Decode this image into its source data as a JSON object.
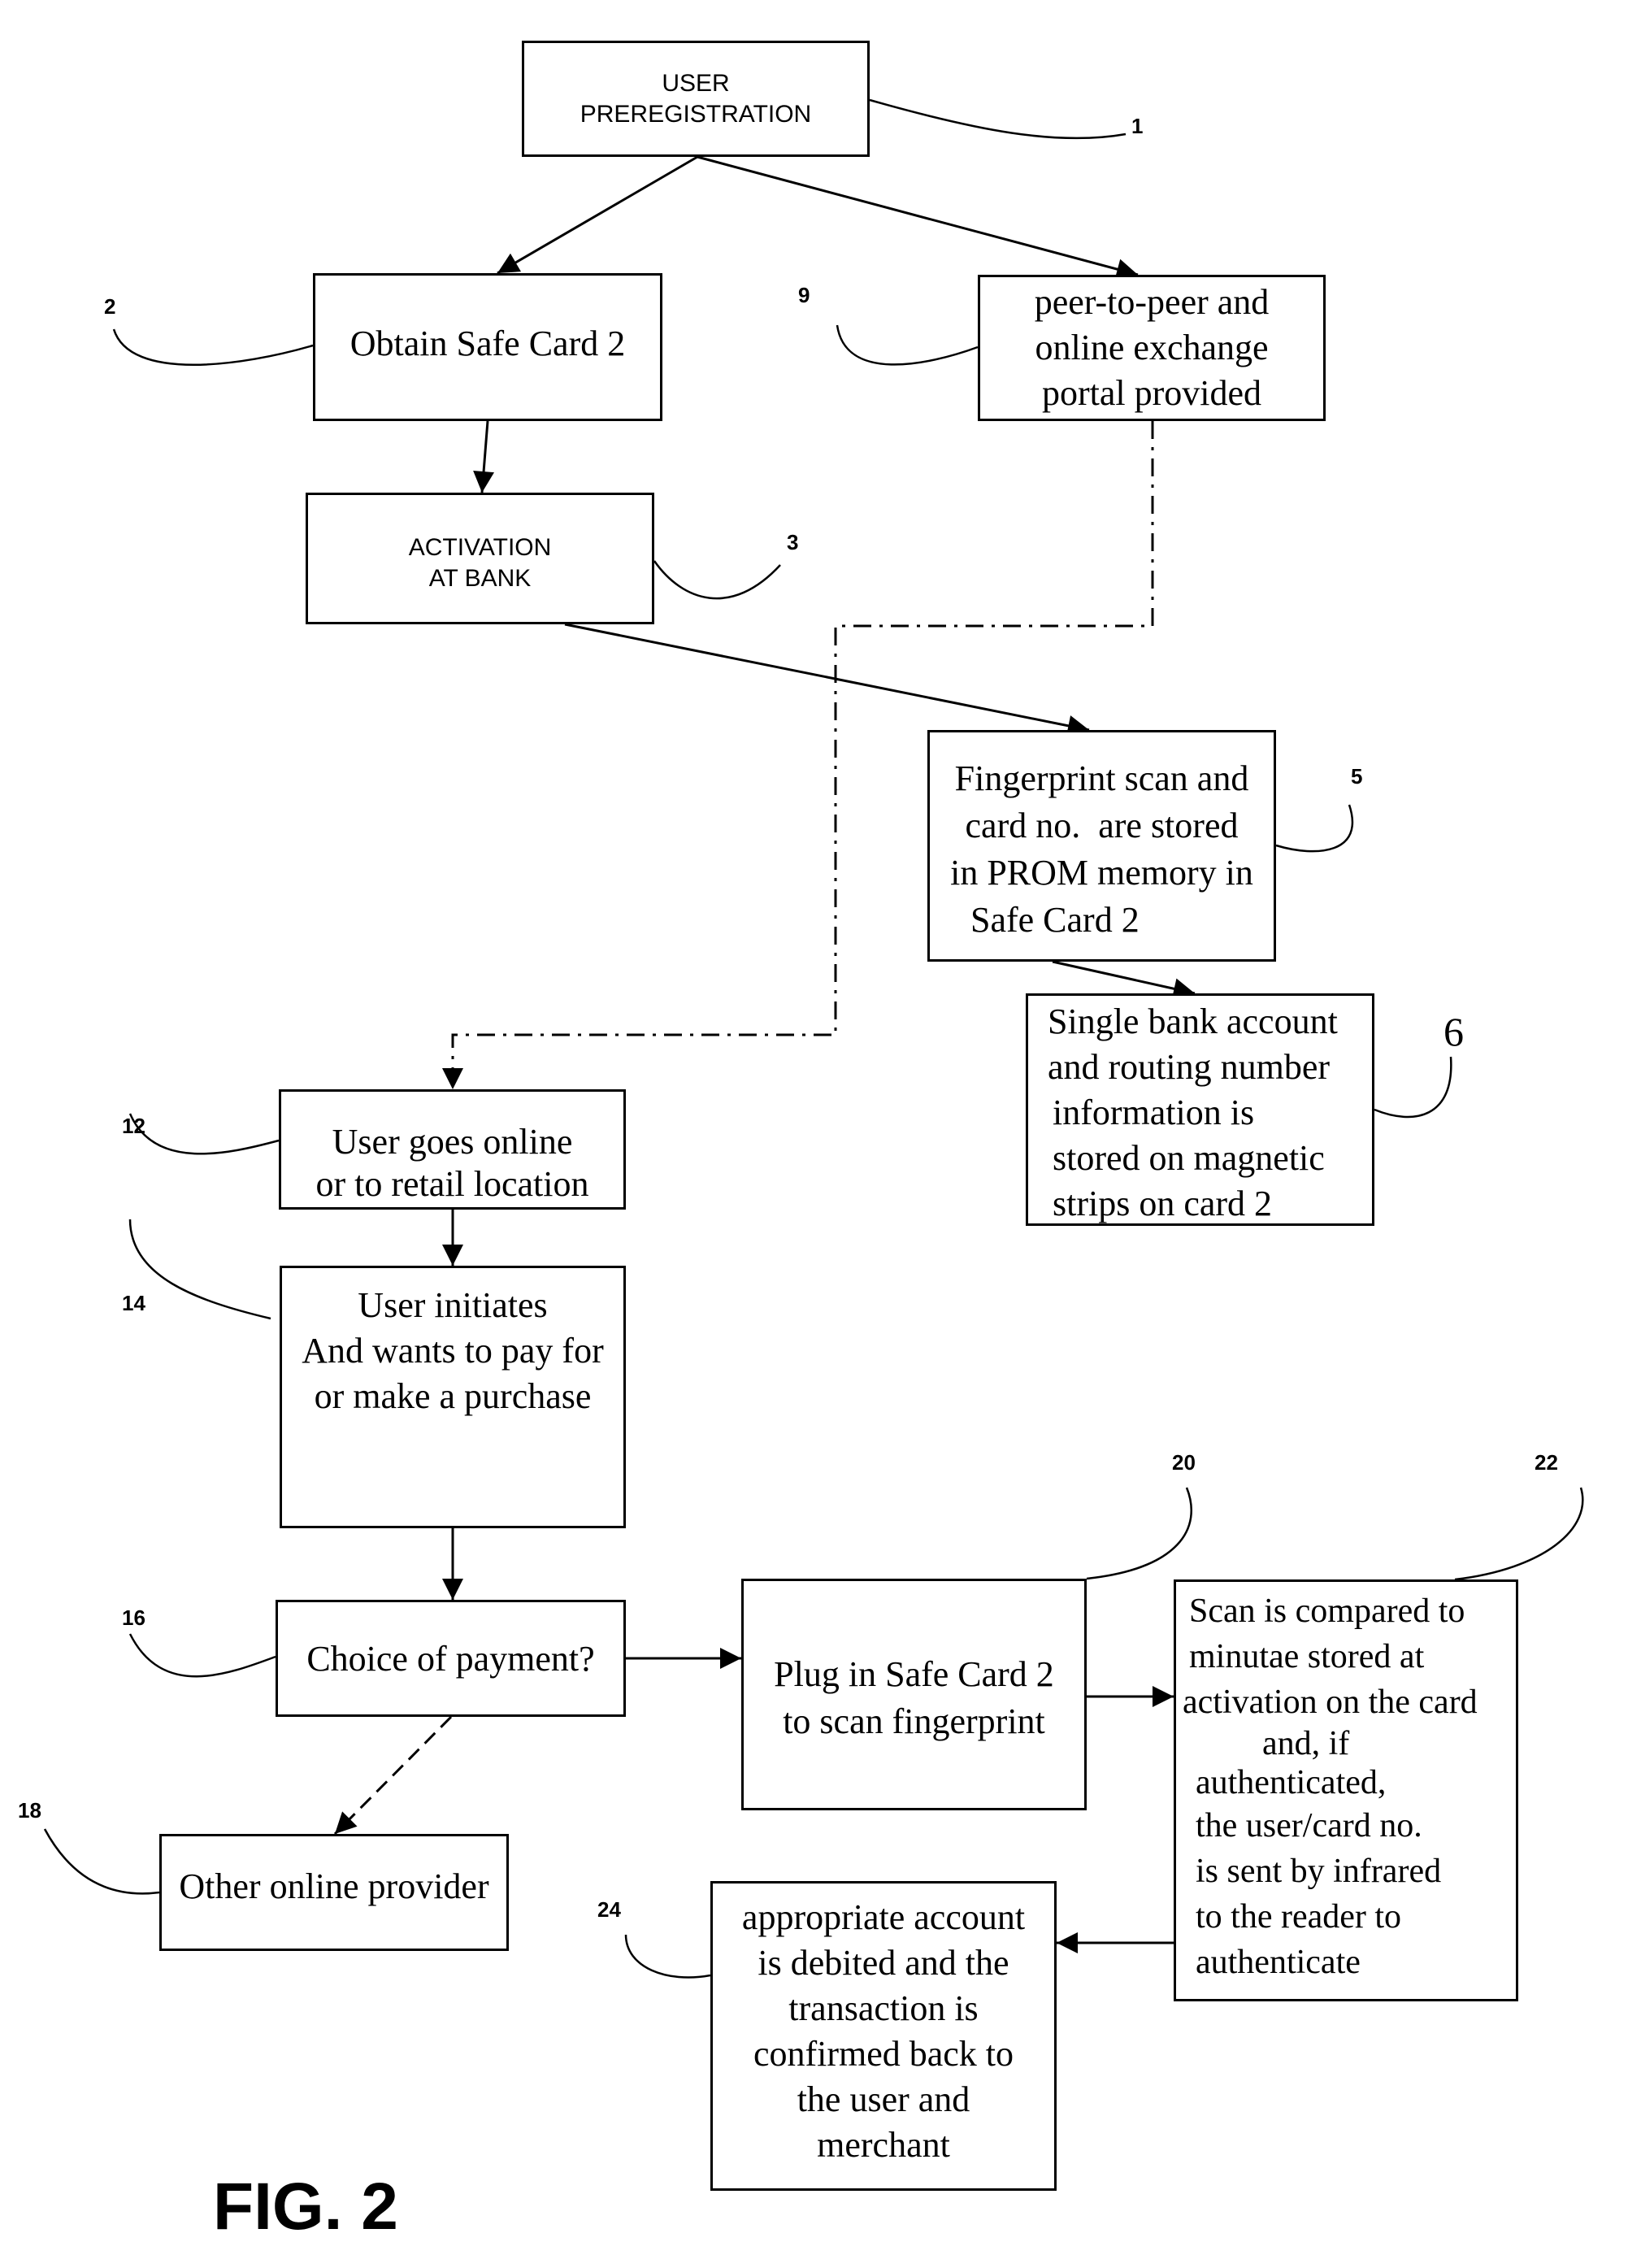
{
  "figure": {
    "label": "FIG. 2"
  },
  "nodes": {
    "n1": {
      "ref": "1",
      "lines": [
        "USER",
        "PREREGISTRATION"
      ]
    },
    "n2": {
      "ref": "2",
      "lines": [
        "Obtain Safe Card 2"
      ]
    },
    "n3": {
      "ref": "3",
      "lines": [
        "ACTIVATION",
        "AT BANK"
      ]
    },
    "n5": {
      "ref": "5",
      "lines": [
        "Fingerprint scan and",
        "card no.  are stored",
        "in PROM memory in",
        "Safe Card 2"
      ]
    },
    "n6": {
      "ref": "6",
      "lines": [
        "Single bank account",
        "and routing number",
        "information is",
        "stored on magnetic",
        "strips on card 2"
      ]
    },
    "n9": {
      "ref": "9",
      "lines": [
        "peer-to-peer and",
        "online exchange",
        "portal provided"
      ]
    },
    "n12": {
      "ref": "12",
      "lines": [
        "User goes online",
        "or to retail location"
      ]
    },
    "n14": {
      "ref": "14",
      "lines": [
        "User initiates",
        "And wants to pay for",
        "or make a purchase"
      ]
    },
    "n16": {
      "ref": "16",
      "lines": [
        "Choice of payment?"
      ]
    },
    "n18": {
      "ref": "18",
      "lines": [
        "Other online provider"
      ]
    },
    "n20": {
      "ref": "20",
      "lines": [
        "Plug in Safe Card 2",
        "to scan fingerprint"
      ]
    },
    "n22": {
      "ref": "22",
      "lines": [
        "Scan is compared to",
        "minutae stored at",
        "activation on the card",
        "and, if",
        "authenticated,",
        "the user/card no.",
        "is sent by infrared",
        "to the reader to",
        "authenticate"
      ]
    },
    "n24": {
      "ref": "24",
      "lines": [
        "appropriate account",
        "is debited and the",
        "transaction is",
        "confirmed back to",
        "the user and",
        "merchant"
      ]
    }
  },
  "edges": [
    {
      "from": "n1",
      "to": "n2",
      "style": "solid"
    },
    {
      "from": "n1",
      "to": "n9",
      "style": "solid"
    },
    {
      "from": "n2",
      "to": "n3",
      "style": "solid"
    },
    {
      "from": "n3",
      "to": "n5",
      "style": "solid"
    },
    {
      "from": "n5",
      "to": "n6",
      "style": "solid"
    },
    {
      "from": "n9",
      "to": "n12",
      "style": "dash-dot"
    },
    {
      "from": "n12",
      "to": "n14",
      "style": "solid"
    },
    {
      "from": "n14",
      "to": "n16",
      "style": "solid"
    },
    {
      "from": "n16",
      "to": "n20",
      "style": "solid"
    },
    {
      "from": "n16",
      "to": "n18",
      "style": "dashed"
    },
    {
      "from": "n20",
      "to": "n22",
      "style": "solid"
    },
    {
      "from": "n22",
      "to": "n24",
      "style": "solid"
    }
  ]
}
